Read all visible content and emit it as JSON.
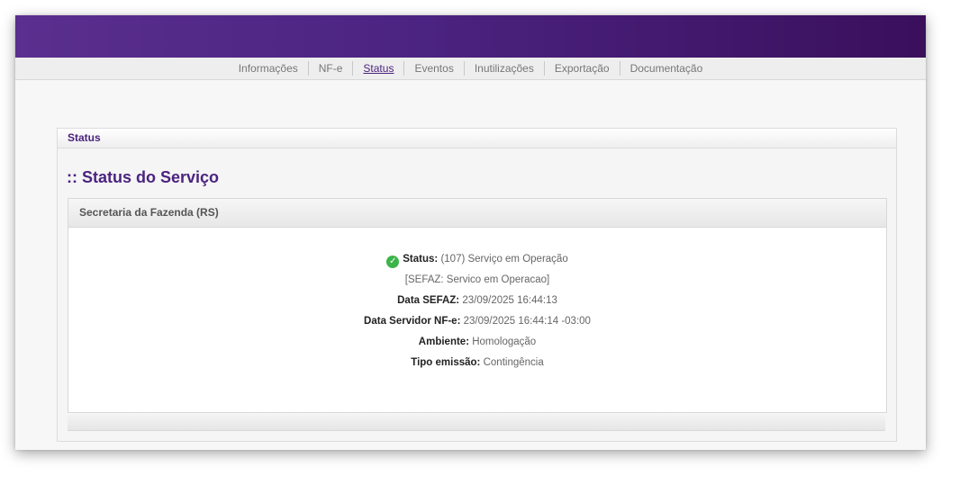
{
  "nav": {
    "items": [
      {
        "label": "Informações"
      },
      {
        "label": "NF-e"
      },
      {
        "label": "Status"
      },
      {
        "label": "Eventos"
      },
      {
        "label": "Inutilizações"
      },
      {
        "label": "Exportação"
      },
      {
        "label": "Documentação"
      }
    ],
    "active": "Status"
  },
  "panel": {
    "header": "Status",
    "section_title": ":: Status do Serviço",
    "sub_header": "Secretaria da Fazenda (RS)"
  },
  "status": {
    "status_label": "Status:",
    "status_value": "(107) Serviço em Operação",
    "sefaz_message": "[SEFAZ: Servico em Operacao]",
    "data_sefaz_label": "Data SEFAZ:",
    "data_sefaz_value": "23/09/2025 16:44:13",
    "data_servidor_label": "Data Servidor NF-e:",
    "data_servidor_value": "23/09/2025 16:44:14 -03:00",
    "ambiente_label": "Ambiente:",
    "ambiente_value": "Homologação",
    "tipo_label": "Tipo emissão:",
    "tipo_value": "Contingência",
    "icon": "check-circle-icon",
    "icon_color": "#3cb44a"
  },
  "colors": {
    "brand": "#4b2380"
  }
}
